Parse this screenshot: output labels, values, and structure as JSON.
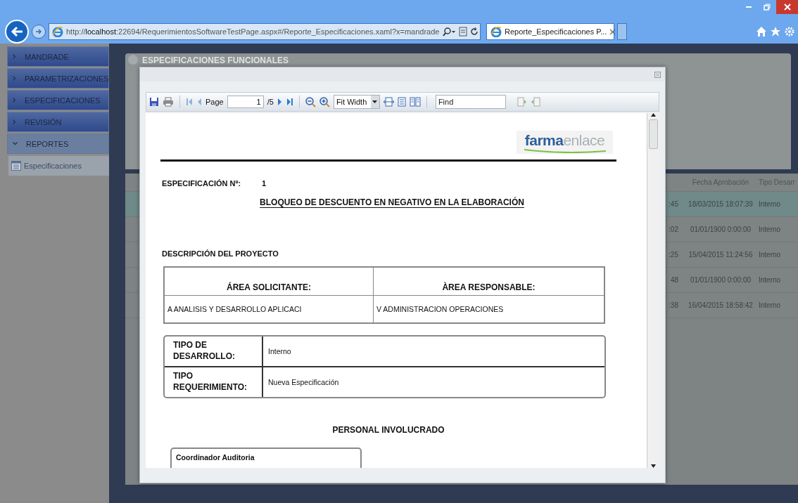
{
  "browser": {
    "address": "http://**localhost**:22694/RequerimientosSoftwareTestPage.aspx#/Reporte_Especificaciones.xaml?x=mandrade",
    "tabs": [
      {
        "title": "Reporte_Especificaciones P...",
        "selected": true
      }
    ]
  },
  "sidebar": {
    "items": [
      {
        "label": "MANDRADE",
        "expanded": false
      },
      {
        "label": "PARAMETRIZACIONES",
        "expanded": false
      },
      {
        "label": "ESPECIFICACIONES",
        "expanded": false
      },
      {
        "label": "REVISIÓN",
        "expanded": false
      },
      {
        "label": "REPORTES",
        "expanded": true,
        "children": [
          {
            "label": "Especificaciones"
          }
        ]
      }
    ]
  },
  "background_panel": {
    "title": "ESPECIFICACIONES FUNCIONALES"
  },
  "background_table": {
    "columns": [
      "",
      "Fecha Aprobación",
      "Tipo Desarr"
    ],
    "rows": [
      {
        "cells": [
          ":45",
          "18/03/2015 18:07:39",
          "Interno"
        ],
        "selected": true
      },
      {
        "cells": [
          ":02",
          "01/01/1900 0:00:00",
          "Interno"
        ],
        "selected": false
      },
      {
        "cells": [
          ":25",
          "15/04/2015 11:24:56",
          "Interno"
        ],
        "selected": false
      },
      {
        "cells": [
          "48",
          "01/01/1900 0:00:00",
          "Interno"
        ],
        "selected": false
      },
      {
        "cells": [
          ":38",
          "16/04/2015 18:58:42",
          "Interno"
        ],
        "selected": false
      }
    ]
  },
  "dialog": {
    "toolbar": {
      "page_label": "Page",
      "page_number": "1",
      "page_count": "/5",
      "zoom": "Fit Width",
      "find_placeholder": "Find"
    },
    "report": {
      "logo": "**farma**enlace",
      "spec_label": "ESPECIFICACIÓN Nº:",
      "spec_number": "1",
      "title": "BLOQUEO DE DESCUENTO EN NEGATIVO EN LA ELABORACIÓN",
      "section": "DESCRIPCIÓN DEL PROYECTO",
      "areas": [
        {
          "header": "ÁREA SOLICITANTE:",
          "value": "A ANALISIS Y DESARROLLO APLICACI"
        },
        {
          "header": "ÀREA RESPONSABLE:",
          "value": "V ADMINISTRACION OPERACIONES"
        }
      ],
      "details": [
        {
          "label_lines": [
            "TIPO DE",
            "DESARROLLO:"
          ],
          "value": "Interno"
        },
        {
          "label_lines": [
            "TIPO",
            "REQUERIMIENTO:"
          ],
          "value": "Nueva Especificación"
        }
      ],
      "personal_title": "PERSONAL INVOLUCRADO",
      "personal": [
        {
          "role": "Coordinador Auditoria"
        }
      ]
    }
  }
}
